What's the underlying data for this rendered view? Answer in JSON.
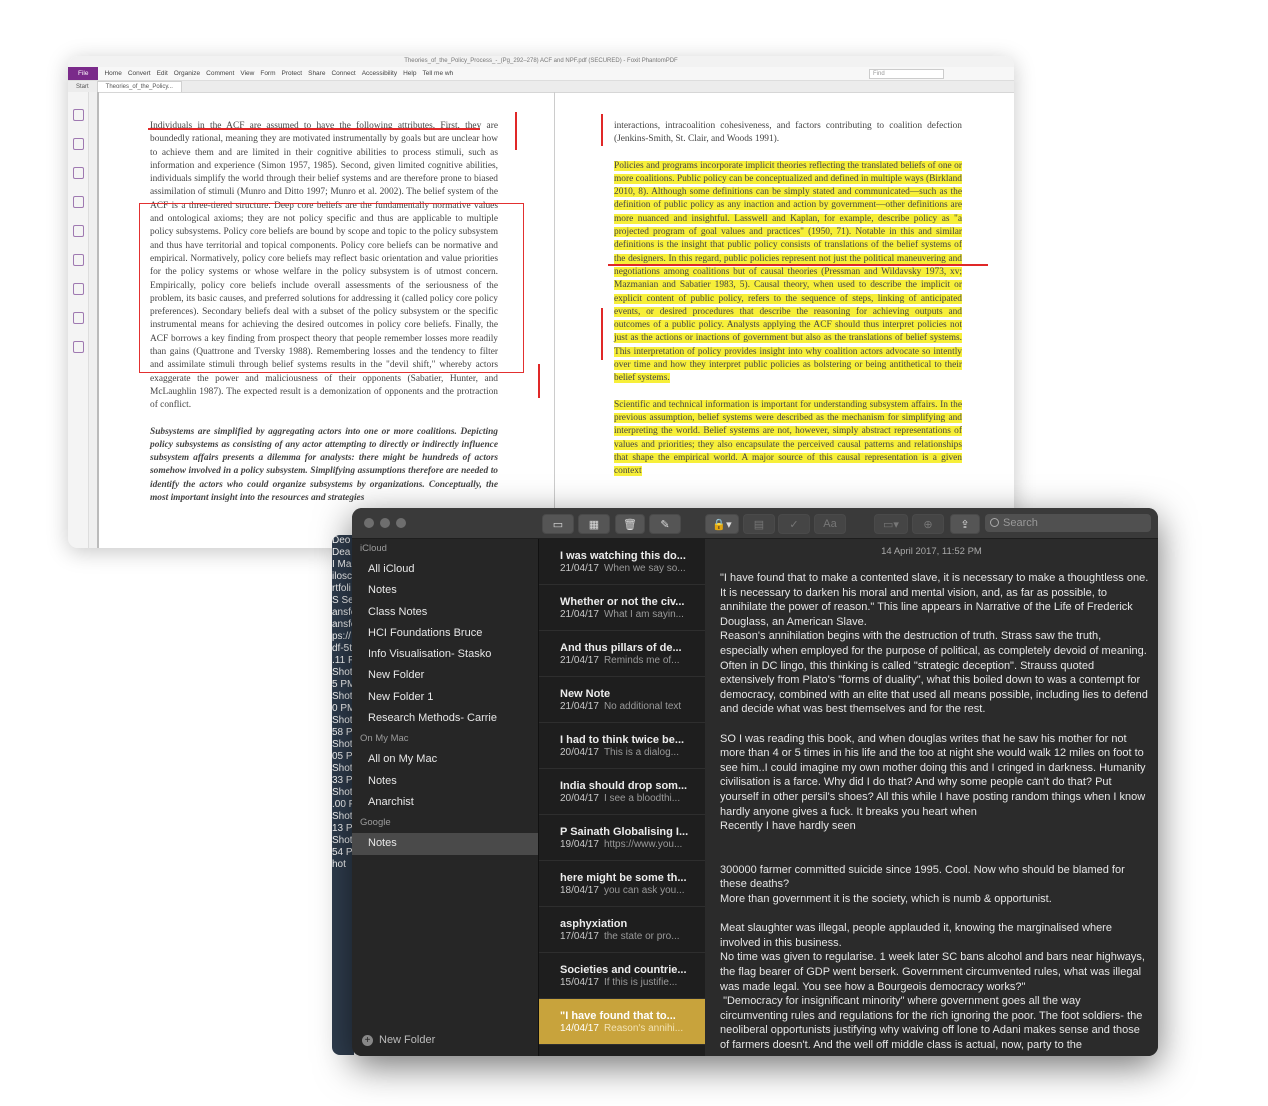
{
  "pdf": {
    "title": "Theories_of_the_Policy_Process_-_(Pg_292–278) ACF and NPF.pdf (SECURED) - Foxit PhantomPDF",
    "menu": [
      "File",
      "Home",
      "Convert",
      "Edit",
      "Organize",
      "Comment",
      "View",
      "Form",
      "Protect",
      "Share",
      "Connect",
      "Accessibility",
      "Help",
      "Tell me wh"
    ],
    "find_placeholder": "Find",
    "tabs": [
      "Start",
      "Theories_of_the_Policy..."
    ],
    "left_page": [
      "Individuals in the ACF are assumed to have the following attributes. First, they are boundedly rational, meaning they are motivated instrumentally by goals but are unclear how to achieve them and are limited in their cognitive abilities to process stimuli, such as information and experience (Simon 1957, 1985). Second, given limited cognitive abilities, individuals simplify the world through their belief systems and are therefore prone to biased assimilation of stimuli (Munro and Ditto 1997; Munro et al. 2002). The belief system of the ACF is a three-tiered structure. Deep core beliefs are the fundamentally normative values and ontological axioms; they are not policy specific and thus are applicable to multiple policy subsystems. Policy core beliefs are bound by scope and topic to the policy subsystem and thus have territorial and topical components. Policy core beliefs can be normative and empirical. Normatively, policy core beliefs may reflect basic orientation and value priorities for the policy systems or whose welfare in the policy subsystem is of utmost concern. Empirically, policy core beliefs include overall assessments of the seriousness of the problem, its basic causes, and preferred solutions for addressing it (called policy core policy preferences). Secondary beliefs deal with a subset of the policy subsystem or the specific instrumental means for achieving the desired outcomes in policy core beliefs. Finally, the ACF borrows a key finding from prospect theory that people remember losses more readily than gains (Quattrone and Tversky 1988). Remembering losses and the tendency to filter and assimilate stimuli through belief systems results in the \"devil shift,\" whereby actors exaggerate the power and maliciousness of their opponents (Sabatier, Hunter, and McLaughlin 1987). The expected result is a demonization of opponents and the protraction of conflict.",
      "Subsystems are simplified by aggregating actors into one or more coalitions. Depicting policy subsystems as consisting of any actor attempting to directly or indirectly influence subsystem affairs presents a dilemma for analysts: there might be hundreds of actors somehow involved in a policy subsystem. Simplifying assumptions therefore are needed to identify the actors who could organize subsystems by organizations. Conceptually, the most important insight into the resources and strategies"
    ],
    "right_page": [
      "interactions, intracoalition cohesiveness, and factors contributing to coalition defection (Jenkins-Smith, St. Clair, and Woods 1991).",
      "Policies and programs incorporate implicit theories reflecting the translated beliefs of one or more coalitions. Public policy can be conceptualized and defined in multiple ways (Birkland 2010, 8). Although some definitions can be simply stated and communicated—such as the definition of public policy as any inaction and action by government—other definitions are more nuanced and insightful. Lasswell and Kaplan, for example, describe policy as \"a projected program of goal values and practices\" (1950, 71). Notable in this and similar definitions is the insight that public policy consists of translations of the belief systems of the designers. In this regard, public policies represent not just the political maneuvering and negotiations among coalitions but of causal theories (Pressman and Wildavsky 1973, xv; Mazmanian and Sabatier 1983, 5). Causal theory, when used to describe the implicit or explicit content of public policy, refers to the sequence of steps, linking of anticipated events, or desired procedures that describe the reasoning for achieving outputs and outcomes of a public policy. Analysts applying the ACF should thus interpret policies not just as the actions or inactions of government but also as the translations of belief systems. This interpretation of policy provides insight into why coalition actors advocate so intently over time and how they interpret public policies as bolstering or being antithetical to their belief systems.",
      "Scientific and technical information is important for understanding subsystem affairs. In the previous assumption, belief systems were described as the mechanism for simplifying and interpreting the world. Belief systems are not, however, simply abstract representations of values and priorities; they also encapsulate the perceived causal patterns and relationships that shape the empirical world. A major source of this causal representation is a given context"
    ]
  },
  "behind_window_text": [
    "Deo",
    "Dea",
    "I Ma",
    "ilosc",
    "rtfoli",
    "S Se",
    "ansfe",
    "ansfe",
    "ps://",
    "df-5t",
    ".11 P",
    "",
    "Shot",
    "5 PM",
    "",
    "Shot",
    "0 PM",
    "",
    "Shot",
    "58 PM",
    "",
    "Shot",
    "05 P",
    "",
    "Shot",
    "33 P",
    "",
    "Shot",
    ".00 P",
    "",
    "Shot",
    "13 P",
    "",
    "Shot",
    "54 P",
    "",
    "",
    "hot"
  ],
  "notes": {
    "search_placeholder": "Search",
    "sidebar": {
      "sections": [
        {
          "header": "iCloud",
          "items": [
            "All iCloud",
            "Notes",
            "Class Notes",
            "HCI Foundations Bruce",
            "Info Visualisation- Stasko",
            "New Folder",
            "New Folder 1",
            "Research Methods- Carrie"
          ]
        },
        {
          "header": "On My Mac",
          "items": [
            "All on My Mac",
            "Notes",
            "Anarchist"
          ]
        },
        {
          "header": "Google",
          "items": [
            "Notes"
          ]
        }
      ],
      "new_folder": "New Folder"
    },
    "list": [
      {
        "title": "I was watching this do...",
        "date": "21/04/17",
        "snippet": "When we say so..."
      },
      {
        "title": "Whether or not the civ...",
        "date": "21/04/17",
        "snippet": "What I am sayin..."
      },
      {
        "title": "And thus pillars of de...",
        "date": "21/04/17",
        "snippet": "Reminds me of..."
      },
      {
        "title": "New Note",
        "date": "21/04/17",
        "snippet": "No additional text"
      },
      {
        "title": "I had to think twice be...",
        "date": "20/04/17",
        "snippet": "This is a dialog..."
      },
      {
        "title": "India should drop som...",
        "date": "20/04/17",
        "snippet": "I see a bloodthi..."
      },
      {
        "title": "P Sainath Globalising I...",
        "date": "19/04/17",
        "snippet": "https://www.you..."
      },
      {
        "title": "here might be some th...",
        "date": "18/04/17",
        "snippet": "you can ask you..."
      },
      {
        "title": "asphyxiation",
        "date": "17/04/17",
        "snippet": "the state or pro..."
      },
      {
        "title": "Societies and countrie...",
        "date": "15/04/17",
        "snippet": "If this is justifie..."
      },
      {
        "title": "\"I have found that to...",
        "date": "14/04/17",
        "snippet": "Reason's annihi..."
      }
    ],
    "editor": {
      "date": "14 April 2017, 11:52 PM",
      "body": "\"I have found that to make a contented slave, it is necessary to make a thoughtless one. It is necessary to darken his moral and mental vision, and, as far as possible, to annihilate the power of reason.\" This line appears in Narrative of the Life of Frederick Douglass, an American Slave.\nReason's annihilation begins with the destruction of truth. Strass saw the truth, especially when employed for the purpose of political, as completely devoid of meaning. Often in DC lingo, this thinking is called \"strategic deception\". Strauss quoted extensively from Plato's \"forms of duality\", what this boiled down to was a contempt for democracy, combined with an elite that used all means possible, including lies to defend and decide what was best themselves and for the rest.\n\nSO I was reading this book, and when douglas writes that he saw his mother for not more than 4 or 5 times in his life and the too at night she would walk 12 miles on foot to see him..I could imagine my own mother doing this and I cringed in darkness. Humanity civilisation is a farce. Why did I do that? And why some people can't do that? Put yourself in other persil's shoes? All this while I have posting random things when I know hardly anyone gives a fuck. It breaks you heart when\nRecently I have hardly seen\n\n\n300000 farmer committed suicide since 1995. Cool. Now who should be blamed for these deaths?\nMore than government it is the society, which is numb & opportunist.\n\nMeat slaughter was illegal, people applauded it, knowing the marginalised where involved in this business.\nNo time was given to regularise. 1 week later SC bans alcohol and bars near highways, the flag bearer of GDP went berserk. Government circumvented rules, what was illegal was made legal. You see how a Bourgeois democracy works?\"\n \"Democracy for insignificant minority\" where government goes all the way circumventing rules and regulations for the rich ignoring the poor. The foot soldiers- the neoliberal opportunists justifying why waiving off lone to Adani makes sense and those of farmers doesn't. And the well off middle class is actual, now, party to the"
    }
  }
}
